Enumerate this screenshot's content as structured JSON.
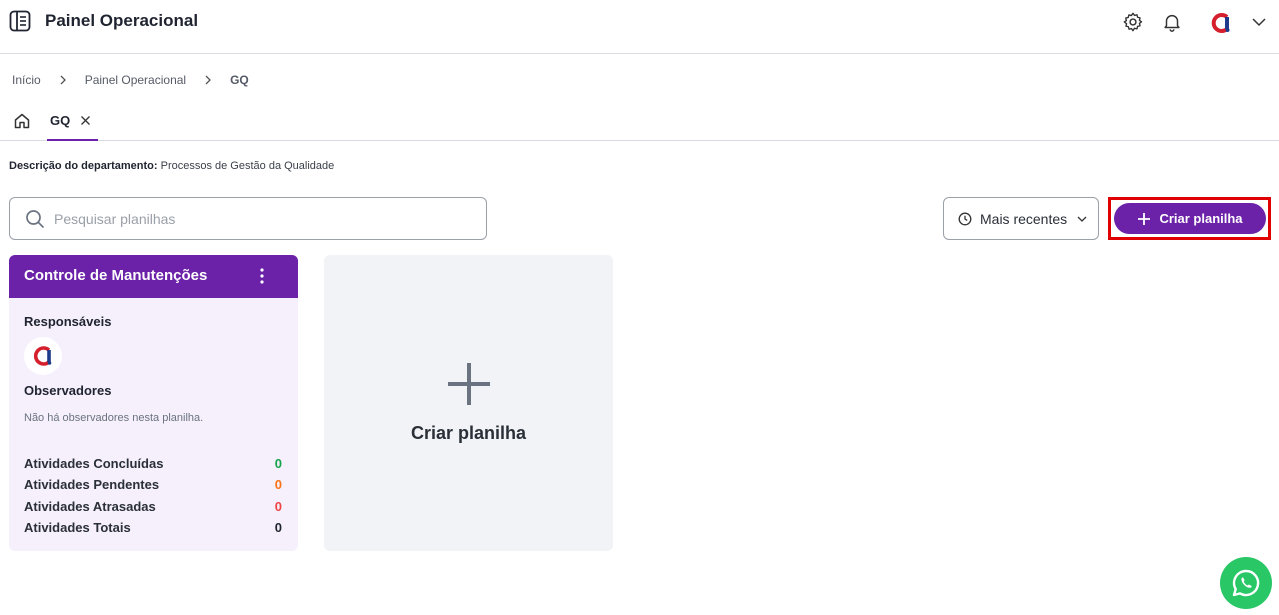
{
  "header": {
    "title": "Painel Operacional",
    "icons": [
      "menu-book-icon",
      "gear-icon",
      "bell-icon",
      "avatar-logo",
      "chevron-down-icon"
    ]
  },
  "breadcrumb": {
    "items": [
      "Início",
      "Painel Operacional",
      "GQ"
    ]
  },
  "tabs": {
    "home_icon": "home-icon",
    "active_label": "GQ"
  },
  "department": {
    "label": "Descrição do departamento:",
    "value": "Processos de Gestão da Qualidade"
  },
  "search": {
    "placeholder": "Pesquisar planilhas",
    "value": ""
  },
  "sort": {
    "label": "Mais recentes"
  },
  "create_button": {
    "label": "Criar planilha"
  },
  "sheet_card": {
    "title": "Controle de Manutenções",
    "responsible_label": "Responsáveis",
    "observers_label": "Observadores",
    "observers_empty": "Não há observadores nesta planilha.",
    "stats": [
      {
        "label": "Atividades Concluídas",
        "value": "0",
        "color": "#16a34a"
      },
      {
        "label": "Atividades Pendentes",
        "value": "0",
        "color": "#f97316"
      },
      {
        "label": "Atividades Atrasadas",
        "value": "0",
        "color": "#ef4444"
      },
      {
        "label": "Atividades Totais",
        "value": "0",
        "color": "#1f2430"
      }
    ]
  },
  "new_card": {
    "label": "Criar planilha"
  },
  "colors": {
    "brand": "#6b21a8",
    "highlight": "#e00000",
    "whatsapp": "#29c766"
  }
}
